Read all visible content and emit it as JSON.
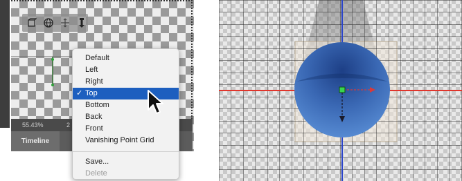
{
  "left_view": {
    "zoom_value": "55.43%",
    "zoom_extra": "2",
    "timeline_tab": "Timeline",
    "toolbar_icons": [
      "cube-icon",
      "orbit-icon",
      "move-icon",
      "camera-icon"
    ]
  },
  "view_menu": {
    "items": [
      {
        "label": "Default",
        "selected": false
      },
      {
        "label": "Left",
        "selected": false
      },
      {
        "label": "Right",
        "selected": false
      },
      {
        "label": "Top",
        "selected": true,
        "check": "✓"
      },
      {
        "label": "Bottom",
        "selected": false
      },
      {
        "label": "Back",
        "selected": false
      },
      {
        "label": "Front",
        "selected": false
      },
      {
        "label": "Vanishing Point Grid",
        "selected": false
      }
    ],
    "save_label": "Save...",
    "delete_label": "Delete"
  },
  "colors": {
    "menu_selection": "#1d5fbf",
    "axis_x": "#e0352b",
    "axis_z": "#2a44c9",
    "cone_blue": "#3f73c2",
    "pivot_green": "#39d44f"
  }
}
